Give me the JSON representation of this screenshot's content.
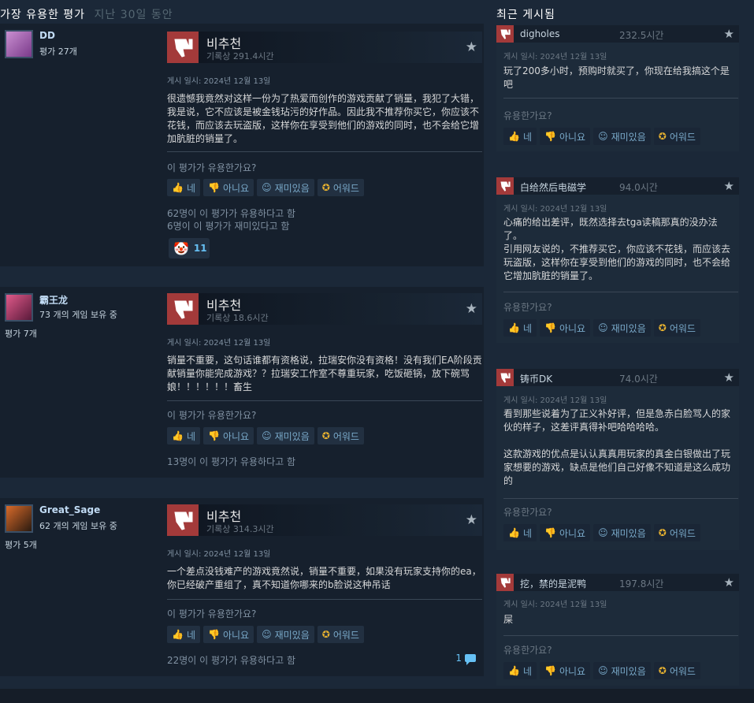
{
  "header": {
    "left_title": "가장 유용한 평가",
    "left_sub": "지난 30일 동안",
    "right_title": "최근 게시됨"
  },
  "buttons": {
    "yes": "네",
    "no": "아니요",
    "funny": "재미있음",
    "award": "어워드"
  },
  "reviews": [
    {
      "author": "DD",
      "author_sub": "평가 27개",
      "author_rev": "",
      "verdict": "비추천",
      "hours": "기록상 291.4시간",
      "posted": "게시 일시: 2024년 12월 13일",
      "text": "很遗憾我竟然对这样一份为了热爱而创作的游戏贡献了销量，我犯了大错，我是说，它不应该是被金钱玷污的好作品。因此我不推荐你买它，你应该不花钱，而应该去玩盗版，这样你在享受到他们的游戏的同时，也不会给它增加肮脏的销量了。",
      "question": "이 평가가 유용한가요?",
      "stats1": "62명이 이 평가가 유용하다고 함",
      "stats2": "6명이 이 평가가 재미있다고 함",
      "reaction_count": "11"
    },
    {
      "author": "霸王龙",
      "author_sub": "73 개의 게임 보유 중",
      "author_rev": "평가 7개",
      "verdict": "비추천",
      "hours": "기록상 18.6시간",
      "posted": "게시 일시: 2024년 12월 13일",
      "text": "销量不重要，这句话谁都有资格说，拉瑞安你没有资格！没有我们EA阶段贡献销量你能完成游戏？？拉瑞安工作室不尊重玩家，吃饭砸锅，放下碗骂娘！！！！！！畜生",
      "question": "이 평가가 유용한가요?",
      "stats1": "13명이 이 평가가 유용하다고 함"
    },
    {
      "author": "Great_Sage",
      "author_sub": "62 개의 게임 보유 중",
      "author_rev": "평가 5개",
      "verdict": "비추천",
      "hours": "기록상 314.3시간",
      "posted": "게시 일시: 2024년 12월 13일",
      "text": "一个差点没钱难产的游戏竟然说，销量不重要，如果没有玩家支持你的ea，你已经破产重组了，真不知道你哪来的b脸说这种吊话",
      "question": "이 평가가 유용한가요?",
      "stats1": "22명이 이 평가가 유용하다고 함",
      "comment_count": "1"
    }
  ],
  "recent": [
    {
      "name": "digholes",
      "hours": "232.5시간",
      "posted": "게시 일시: 2024년 12월 13일",
      "text": "玩了200多小时，预购时就买了，你现在给我搞这个是吧",
      "question": "유용한가요?"
    },
    {
      "name": "白给然后电磁学",
      "hours": "94.0시간",
      "posted": "게시 일시: 2024년 12월 13일",
      "text": "心痛的给出差评，既然选择去tga读稿那真的没办法了。\n引用网友说的，不推荐买它，你应该不花钱，而应该去玩盗版，这样你在享受到他们的游戏的同时，也不会给它增加肮脏的销量了。",
      "question": "유용한가요?"
    },
    {
      "name": "铸币DK",
      "hours": "74.0시간",
      "posted": "게시 일시: 2024년 12월 13일",
      "text": "看到那些说着为了正义补好评，但是急赤白脸骂人的家伙的样子，这差评真得补吧哈哈哈哈。\n\n这款游戏的优点是认认真真用玩家的真金白银做出了玩家想要的游戏，缺点是他们自己好像不知道是这么成功的",
      "question": "유용한가요?"
    },
    {
      "name": "挖，禁的是泥鸭",
      "hours": "197.8시간",
      "posted": "게시 일시: 2024년 12월 13일",
      "text": "屎",
      "question": "유용한가요?"
    }
  ],
  "colors": {
    "background": "#1b2838",
    "thumb_down": "#a33a3a",
    "link": "#66c0f4",
    "award": "#e6b130"
  }
}
